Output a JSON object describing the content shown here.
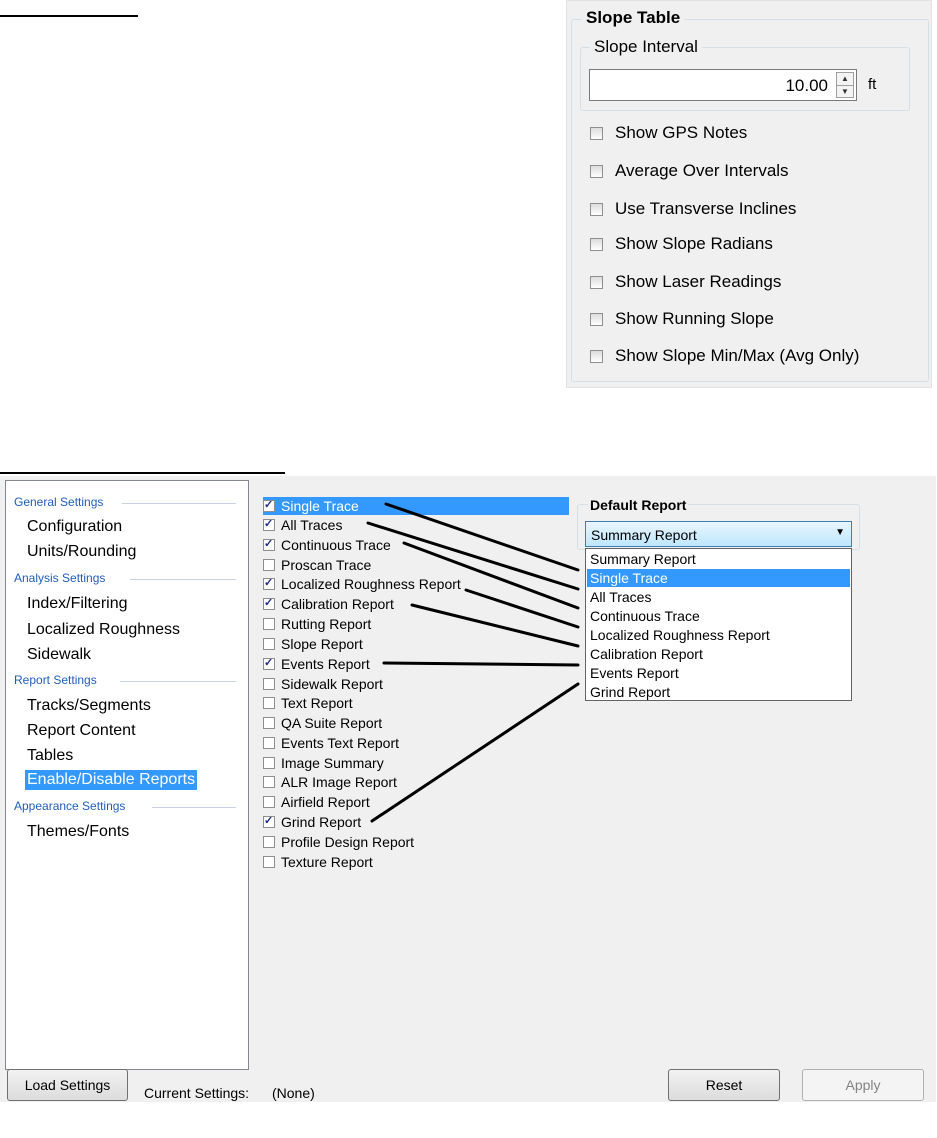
{
  "slope_table": {
    "title": "Slope Table",
    "interval_group": "Slope Interval",
    "interval_value": "10.00",
    "unit": "ft",
    "options": [
      {
        "label": "Show GPS Notes",
        "checked": false
      },
      {
        "label": "Average Over Intervals",
        "checked": false
      },
      {
        "label": "Use Transverse Inclines",
        "checked": false
      },
      {
        "label": "Show Slope Radians",
        "checked": false
      },
      {
        "label": "Show Laser Readings",
        "checked": false
      },
      {
        "label": "Show Running Slope",
        "checked": false
      },
      {
        "label": "Show Slope Min/Max (Avg Only)",
        "checked": false
      }
    ]
  },
  "sidebar": {
    "sections": [
      {
        "heading": "General Settings",
        "items": [
          "Configuration",
          "Units/Rounding"
        ]
      },
      {
        "heading": "Analysis Settings",
        "items": [
          "Index/Filtering",
          "Localized Roughness",
          "Sidewalk"
        ]
      },
      {
        "heading": "Report Settings",
        "items": [
          "Tracks/Segments",
          "Report Content",
          "Tables",
          "Enable/Disable Reports"
        ]
      },
      {
        "heading": "Appearance Settings",
        "items": [
          "Themes/Fonts"
        ]
      }
    ],
    "selected": "Enable/Disable Reports"
  },
  "reports": [
    {
      "label": "Single Trace",
      "checked": true,
      "selected": true
    },
    {
      "label": "All Traces",
      "checked": true
    },
    {
      "label": "Continuous Trace",
      "checked": true
    },
    {
      "label": "Proscan Trace",
      "checked": false
    },
    {
      "label": "Localized Roughness Report",
      "checked": true
    },
    {
      "label": "Calibration Report",
      "checked": true
    },
    {
      "label": "Rutting Report",
      "checked": false
    },
    {
      "label": "Slope Report",
      "checked": false
    },
    {
      "label": "Events Report",
      "checked": true
    },
    {
      "label": "Sidewalk Report",
      "checked": false
    },
    {
      "label": "Text Report",
      "checked": false
    },
    {
      "label": "QA Suite Report",
      "checked": false
    },
    {
      "label": "Events Text Report",
      "checked": false
    },
    {
      "label": "Image Summary",
      "checked": false
    },
    {
      "label": "ALR Image Report",
      "checked": false
    },
    {
      "label": "Airfield Report",
      "checked": false
    },
    {
      "label": "Grind Report",
      "checked": true
    },
    {
      "label": "Profile Design Report",
      "checked": false
    },
    {
      "label": "Texture Report",
      "checked": false
    }
  ],
  "default_report": {
    "title": "Default Report",
    "selected": "Summary Report",
    "highlighted": "Single Trace",
    "options": [
      "Summary Report",
      "Single Trace",
      "All Traces",
      "Continuous Trace",
      "Localized Roughness Report",
      "Calibration Report",
      "Events Report",
      "Grind Report"
    ]
  },
  "footer": {
    "load_label": "Load Settings",
    "current_label": "Current Settings:",
    "current_value": "(None)",
    "reset_label": "Reset",
    "apply_label": "Apply"
  },
  "colors": {
    "selection": "#3399ff",
    "heading": "#1e5ebc",
    "dialog_bg": "#f0f0f0"
  }
}
